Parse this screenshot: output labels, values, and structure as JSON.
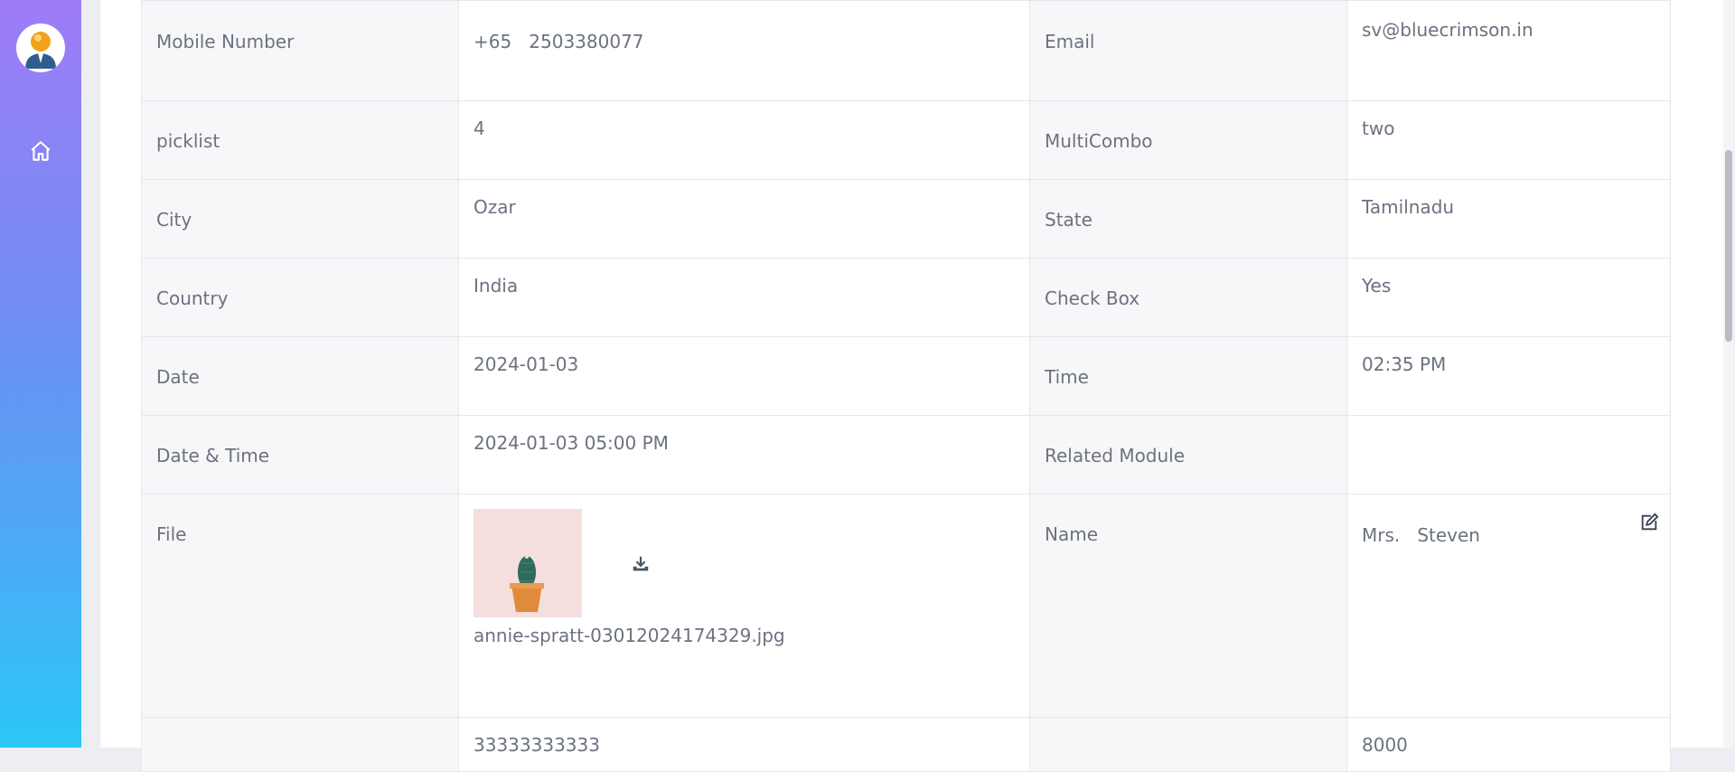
{
  "rows": [
    {
      "label1": "Mobile Number",
      "value1": "+65   2503380077",
      "label2": "Email",
      "value2": "sv@bluecrimson.in"
    },
    {
      "label1": "picklist",
      "value1": "4",
      "label2": "MultiCombo",
      "value2": "two"
    },
    {
      "label1": "City",
      "value1": "Ozar",
      "label2": "State",
      "value2": "Tamilnadu"
    },
    {
      "label1": "Country",
      "value1": "India",
      "label2": "Check Box",
      "value2": "Yes"
    },
    {
      "label1": "Date",
      "value1": "2024-01-03",
      "label2": "Time",
      "value2": "02:35 PM"
    },
    {
      "label1": "Date & Time",
      "value1": "2024-01-03 05:00 PM",
      "label2": "Related Module",
      "value2": ""
    }
  ],
  "file_row": {
    "label1": "File",
    "file_name": "annie-spratt-03012024174329.jpg",
    "label2": "Name",
    "value2": "Mrs.   Steven"
  },
  "partial_row": {
    "label1": "",
    "value1": "33333333333",
    "label2": "",
    "value2": "8000"
  },
  "icons": {
    "home": "home-icon",
    "download": "download-icon",
    "edit": "edit-icon"
  },
  "colors": {
    "sidebar_top": "#9f7cf7",
    "sidebar_bottom": "#2bc6f6",
    "label_bg": "#f7f7f9",
    "text": "#6b7280"
  }
}
